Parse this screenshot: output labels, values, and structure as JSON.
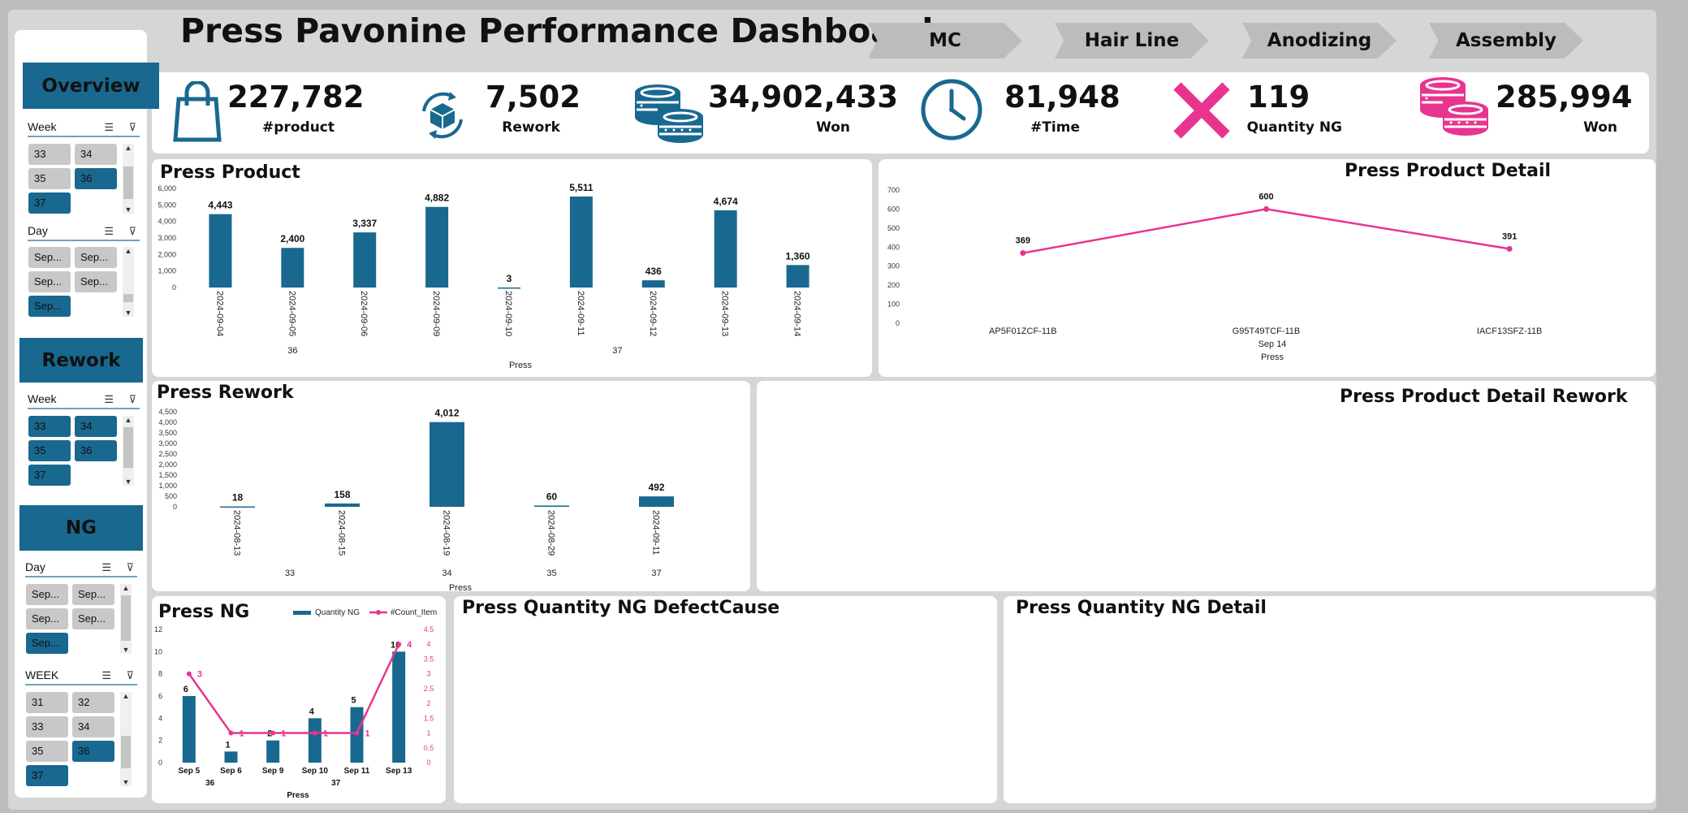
{
  "title": "Press Pavonine Performance Dashboard",
  "nav": [
    "MC",
    "Hair Line",
    "Anodizing",
    "Assembly"
  ],
  "kpis": [
    {
      "icon": "shopping-bag-icon",
      "value": "227,782",
      "label": "#product"
    },
    {
      "icon": "recycle-box-icon",
      "value": "7,502",
      "label": "Rework"
    },
    {
      "icon": "coins-icon",
      "value": "34,902,433",
      "label": "Won"
    },
    {
      "icon": "clock-icon",
      "value": "81,948",
      "label": "#Time"
    },
    {
      "icon": "x-mark-icon",
      "value": "119",
      "label": "Quantity NG"
    },
    {
      "icon": "coins-icon",
      "value": "285,994",
      "label": "Won"
    }
  ],
  "colors": {
    "bar": "#19688f",
    "accent": "#e8348f",
    "frame": "#d6d6d6"
  },
  "sidebar": {
    "overview": {
      "header": "Overview",
      "week": {
        "label": "Week",
        "items": [
          {
            "t": "33",
            "on": false
          },
          {
            "t": "34",
            "on": false
          },
          {
            "t": "35",
            "on": false
          },
          {
            "t": "36",
            "on": true
          },
          {
            "t": "37",
            "on": true
          }
        ]
      },
      "day": {
        "label": "Day",
        "items": [
          {
            "t": "Sep...",
            "on": false
          },
          {
            "t": "Sep...",
            "on": false
          },
          {
            "t": "Sep...",
            "on": false
          },
          {
            "t": "Sep...",
            "on": false
          },
          {
            "t": "Sep...",
            "on": true
          }
        ]
      }
    },
    "rework": {
      "header": "Rework",
      "week": {
        "label": "Week",
        "items": [
          {
            "t": "33",
            "on": true
          },
          {
            "t": "34",
            "on": true
          },
          {
            "t": "35",
            "on": true
          },
          {
            "t": "36",
            "on": true
          },
          {
            "t": "37",
            "on": true
          }
        ]
      }
    },
    "ng": {
      "header": "NG",
      "day": {
        "label": "Day",
        "items": [
          {
            "t": "Sep...",
            "on": false
          },
          {
            "t": "Sep...",
            "on": false
          },
          {
            "t": "Sep...",
            "on": false
          },
          {
            "t": "Sep...",
            "on": false
          },
          {
            "t": "Sep...",
            "on": true
          }
        ]
      },
      "week": {
        "label": "WEEK",
        "items": [
          {
            "t": "31",
            "on": false
          },
          {
            "t": "32",
            "on": false
          },
          {
            "t": "33",
            "on": false
          },
          {
            "t": "34",
            "on": false
          },
          {
            "t": "35",
            "on": false
          },
          {
            "t": "36",
            "on": true
          },
          {
            "t": "37",
            "on": true
          }
        ]
      }
    }
  },
  "chart_data": [
    {
      "id": "press-product",
      "type": "bar",
      "title": "Press Product",
      "categories": [
        "2024-09-04",
        "2024-09-05",
        "2024-09-06",
        "2024-09-09",
        "2024-09-10",
        "2024-09-11",
        "2024-09-12",
        "2024-09-13",
        "2024-09-14"
      ],
      "groups": [
        {
          "label": "36",
          "count": 3
        },
        {
          "label": "37",
          "count": 6
        }
      ],
      "values": [
        4443,
        2400,
        3337,
        4882,
        3,
        5511,
        436,
        4674,
        1360
      ],
      "value_labels": [
        "4,443",
        "2,400",
        "3,337",
        "4,882",
        "3",
        "5,511",
        "436",
        "4,674",
        "1,360"
      ],
      "yticks": [
        "0",
        "1,000",
        "2,000",
        "3,000",
        "4,000",
        "5,000",
        "6,000"
      ],
      "ylim": [
        0,
        6000
      ],
      "xlabel": "Press"
    },
    {
      "id": "press-product-detail",
      "type": "line",
      "title": "Press Product Detail",
      "categories": [
        "AP5F01ZCF-11B",
        "G95T49TCF-11B",
        "IACF13SFZ-11B"
      ],
      "values": [
        369,
        600,
        391
      ],
      "value_labels": [
        "369",
        "600",
        "391"
      ],
      "yticks": [
        "0",
        "100",
        "200",
        "300",
        "400",
        "500",
        "600",
        "700"
      ],
      "ylim": [
        0,
        700
      ],
      "group": "Sep 14",
      "xlabel": "Press"
    },
    {
      "id": "press-rework",
      "type": "bar",
      "title": "Press Rework",
      "categories": [
        "2024-08-13",
        "2024-08-15",
        "2024-08-19",
        "2024-08-29",
        "2024-09-11"
      ],
      "groups": [
        {
          "label": "33",
          "count": 2
        },
        {
          "label": "34",
          "count": 1
        },
        {
          "label": "35",
          "count": 1
        },
        {
          "label": "37",
          "count": 1
        }
      ],
      "values": [
        18,
        158,
        4012,
        60,
        492
      ],
      "value_labels": [
        "18",
        "158",
        "4,012",
        "60",
        "492"
      ],
      "yticks": [
        "0",
        "500",
        "1,000",
        "1,500",
        "2,000",
        "2,500",
        "3,000",
        "3,500",
        "4,000",
        "4,500"
      ],
      "ylim": [
        0,
        4500
      ],
      "xlabel": "Press"
    },
    {
      "id": "press-ng",
      "type": "bar",
      "title": "Press NG",
      "categories": [
        "Sep  5",
        "Sep  6",
        "Sep  9",
        "Sep 10",
        "Sep 11",
        "Sep 13"
      ],
      "groups": [
        {
          "label": "36",
          "count": 2
        },
        {
          "label": "37",
          "count": 4
        }
      ],
      "series": [
        {
          "name": "Quantity NG",
          "type": "bar",
          "values": [
            6,
            1,
            2,
            4,
            5,
            10
          ],
          "value_labels": [
            "6",
            "1",
            "2",
            "4",
            "5",
            "10"
          ]
        },
        {
          "name": "#Count_Item",
          "type": "line",
          "values": [
            3,
            1,
            1,
            1,
            1,
            4
          ],
          "value_labels": [
            "3",
            "1",
            "1",
            "1",
            "1",
            "4"
          ]
        }
      ],
      "yticks": [
        "0",
        "2",
        "4",
        "6",
        "8",
        "10",
        "12"
      ],
      "ylim": [
        0,
        12
      ],
      "y2ticks": [
        "0",
        "0.5",
        "1",
        "1.5",
        "2",
        "2.5",
        "3",
        "3.5",
        "4",
        "4.5"
      ],
      "y2lim": [
        0,
        4.5
      ],
      "legend": "top-right",
      "xlabel": "Press"
    }
  ],
  "empty_panels": {
    "detail_rework": "Press Product Detail Rework",
    "ng_defect": "Press Quantity NG DefectCause",
    "ng_detail": "Press Quantity NG Detail"
  }
}
